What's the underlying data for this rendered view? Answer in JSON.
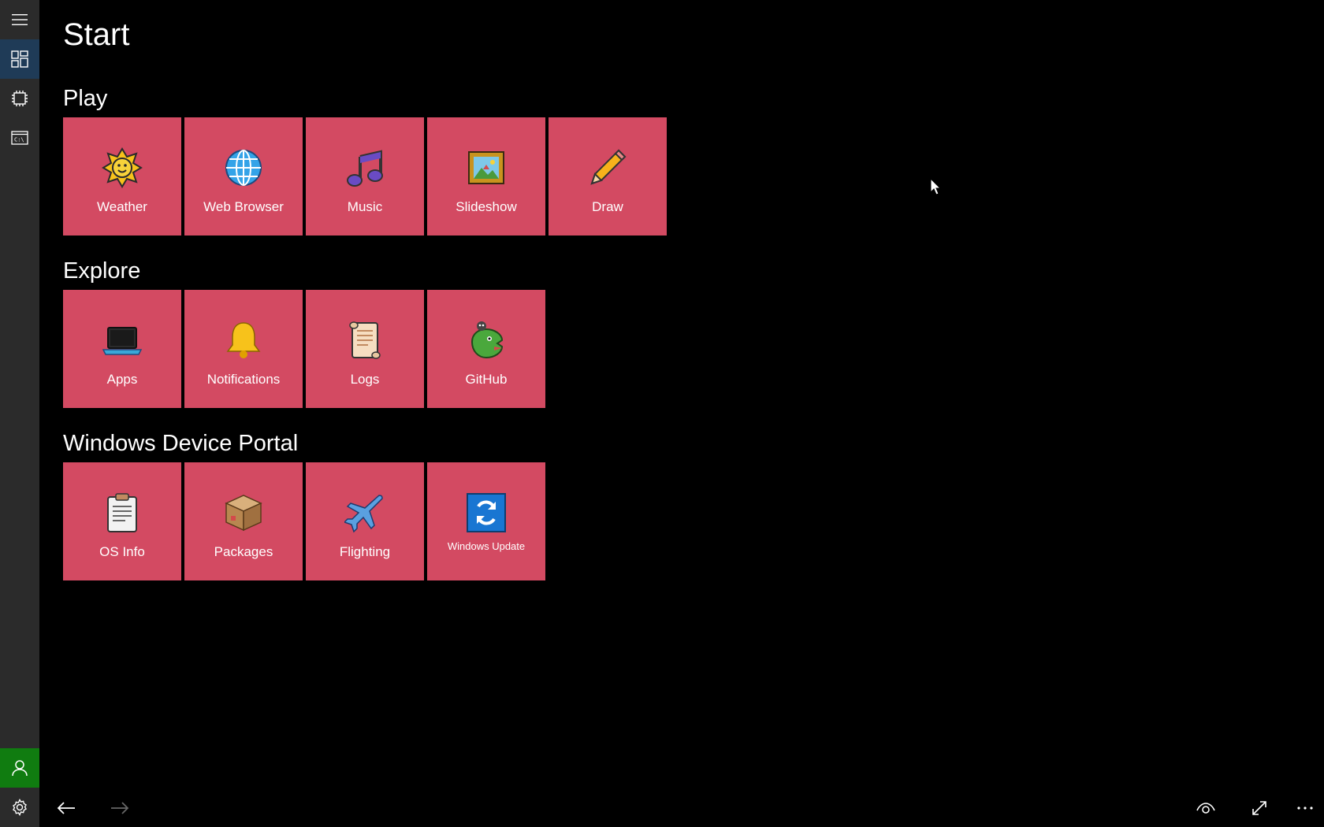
{
  "page": {
    "title": "Start"
  },
  "sidebar": {
    "items": [
      {
        "icon": "hamburger-menu-icon"
      },
      {
        "icon": "tiles-grid-icon",
        "active": true
      },
      {
        "icon": "chip-icon"
      },
      {
        "icon": "command-prompt-icon"
      }
    ],
    "bottom": [
      {
        "icon": "user-icon"
      },
      {
        "icon": "gear-icon"
      }
    ]
  },
  "sections": [
    {
      "title": "Play",
      "tiles": [
        {
          "label": "Weather",
          "icon": "sun-face-icon"
        },
        {
          "label": "Web Browser",
          "icon": "globe-icon"
        },
        {
          "label": "Music",
          "icon": "music-note-icon"
        },
        {
          "label": "Slideshow",
          "icon": "framed-picture-icon"
        },
        {
          "label": "Draw",
          "icon": "pencil-icon"
        }
      ]
    },
    {
      "title": "Explore",
      "tiles": [
        {
          "label": "Apps",
          "icon": "laptop-icon"
        },
        {
          "label": "Notifications",
          "icon": "bell-icon"
        },
        {
          "label": "Logs",
          "icon": "scroll-icon"
        },
        {
          "label": "GitHub",
          "icon": "octocat-dinosaur-icon"
        }
      ]
    },
    {
      "title": "Windows Device Portal",
      "tiles": [
        {
          "label": "OS Info",
          "icon": "clipboard-icon"
        },
        {
          "label": "Packages",
          "icon": "package-box-icon"
        },
        {
          "label": "Flighting",
          "icon": "airplane-icon"
        },
        {
          "label": "Windows Update",
          "icon": "update-arrows-icon"
        }
      ]
    }
  ],
  "bottom_bar": {
    "left": [
      {
        "icon": "back-arrow-icon",
        "enabled": true
      },
      {
        "icon": "forward-arrow-icon",
        "enabled": false
      }
    ],
    "right": [
      {
        "icon": "eye-icon"
      },
      {
        "icon": "fullscreen-icon"
      },
      {
        "icon": "more-icon"
      }
    ]
  },
  "colors": {
    "tile": "#d34a62",
    "sidebar": "#2b2b2b",
    "active": "#1f3b57",
    "user": "#107c10"
  }
}
